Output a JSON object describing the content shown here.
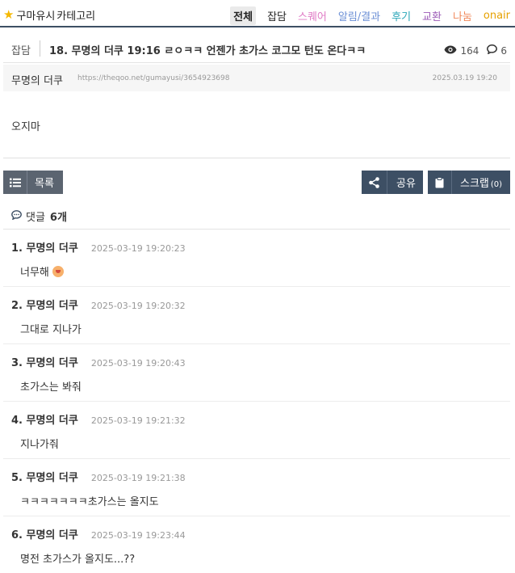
{
  "board": {
    "name": "구마유시",
    "category_menu": "카테고리",
    "tabs": [
      {
        "label": "전체",
        "color": "#222222",
        "active": true
      },
      {
        "label": "잡담",
        "color": "#222222"
      },
      {
        "label": "스퀘어",
        "color": "#e07bc6"
      },
      {
        "label": "알림/결과",
        "color": "#6b8fd6"
      },
      {
        "label": "후기",
        "color": "#2aa6b8"
      },
      {
        "label": "교환",
        "color": "#9b59b6"
      },
      {
        "label": "나눔",
        "color": "#f08a5d"
      },
      {
        "label": "onair",
        "color": "#e6a100"
      }
    ]
  },
  "post": {
    "category": "잡담",
    "title": "18. 무명의 더쿠 19:16 ㄹㅇㅋㅋ 언젠가 초가스 코그모 턴도 온다ㅋㅋ",
    "views": "164",
    "comment_count": "6",
    "author": "무명의 더쿠",
    "url": "https://theqoo.net/gumayusi/3654923698",
    "date": "2025.03.19 19:20",
    "content": "오지마"
  },
  "buttons": {
    "list": "목록",
    "share": "공유",
    "scrap": "스크랩",
    "scrap_count": "(0)"
  },
  "comments_header": {
    "label": "댓글",
    "count": "6개"
  },
  "comments": [
    {
      "name": "1. 무명의 더쿠",
      "time": "2025-03-19 19:20:23",
      "text": "너무해"
    },
    {
      "name": "2. 무명의 더쿠",
      "time": "2025-03-19 19:20:32",
      "text": "그대로 지나가"
    },
    {
      "name": "3. 무명의 더쿠",
      "time": "2025-03-19 19:20:43",
      "text": "초가스는 봐줘"
    },
    {
      "name": "4. 무명의 더쿠",
      "time": "2025-03-19 19:21:32",
      "text": "지나가줘"
    },
    {
      "name": "5. 무명의 더쿠",
      "time": "2025-03-19 19:21:38",
      "text": "ㅋㅋㅋㅋㅋㅋㅋ초가스는 올지도"
    },
    {
      "name": "6. 무명의 더쿠",
      "time": "2025-03-19 19:23:44",
      "text": "명전 초가스가 올지도...??"
    }
  ]
}
